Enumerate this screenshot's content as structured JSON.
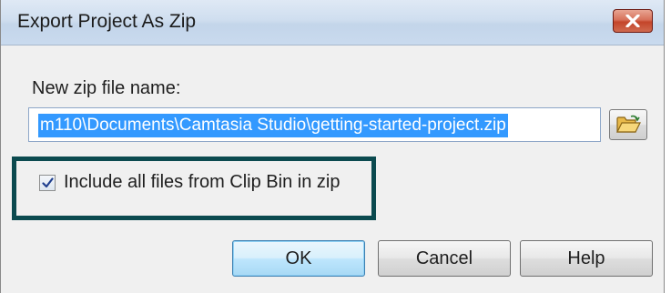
{
  "dialog": {
    "title": "Export Project As Zip",
    "close_label": "Close"
  },
  "form": {
    "file_name_label": "New zip file name:",
    "file_name_value": "m110\\Documents\\Camtasia Studio\\getting-started-project.zip",
    "include_clip_bin_label": "Include all files from Clip Bin in zip",
    "include_clip_bin_checked": true
  },
  "buttons": {
    "ok": "OK",
    "cancel": "Cancel",
    "help": "Help"
  },
  "icons": {
    "close": "close-icon",
    "browse": "folder-open-icon",
    "check": "checkmark-icon"
  },
  "colors": {
    "highlight_border": "#0b4a4f",
    "selection": "#3399ff"
  }
}
